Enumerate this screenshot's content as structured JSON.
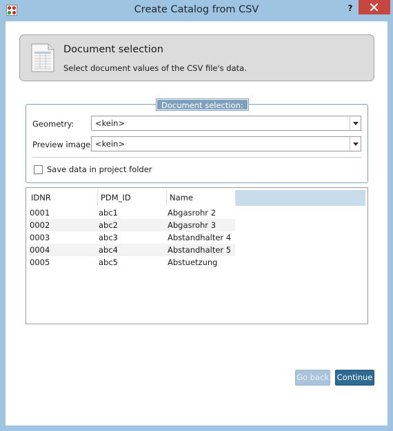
{
  "window": {
    "title": "Create Catalog from CSV",
    "help_label": "?"
  },
  "header": {
    "title": "Document selection",
    "subtitle": "Select document values of the CSV file's data."
  },
  "group": {
    "title": "Document selection:",
    "geometry_label": "Geometry:",
    "geometry_value": "<kein>",
    "preview_label": "Preview image:",
    "preview_value": "<kein>",
    "save_checkbox_label": "Save data in project folder",
    "save_checked": false
  },
  "table": {
    "columns": [
      "IDNR",
      "PDM_ID",
      "Name"
    ],
    "rows": [
      [
        "0001",
        "abc1",
        "Abgasrohr 2"
      ],
      [
        "0002",
        "abc2",
        "Abgasrohr 3"
      ],
      [
        "0003",
        "abc3",
        "Abstandhalter 4"
      ],
      [
        "0004",
        "abc4",
        "Abstandhalter 5"
      ],
      [
        "0005",
        "abc5",
        "Abstuetzung"
      ]
    ]
  },
  "buttons": {
    "back_label": "Go back",
    "continue_label": "Continue"
  },
  "colors": {
    "frame": "#9fc4e2",
    "accent": "#2f6a93",
    "group_title_bg": "#7fa0bc",
    "close_button": "#c7463f"
  }
}
